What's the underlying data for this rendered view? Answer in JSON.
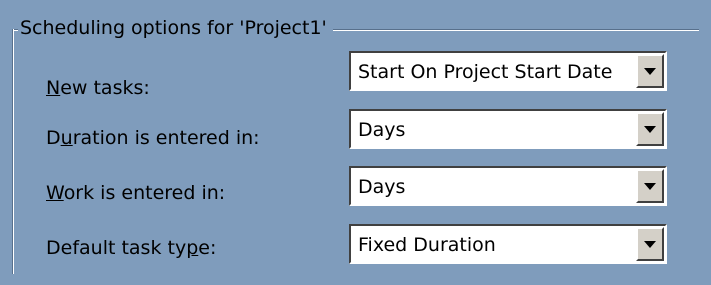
{
  "group": {
    "title": "Scheduling options for 'Project1'"
  },
  "rows": [
    {
      "label_pre": "",
      "label_key": "N",
      "label_post": "ew tasks:",
      "value": "Start On Project Start Date"
    },
    {
      "label_pre": "D",
      "label_key": "u",
      "label_post": "ration is entered in:",
      "value": "Days"
    },
    {
      "label_pre": "",
      "label_key": "W",
      "label_post": "ork is entered in:",
      "value": "Days"
    },
    {
      "label_pre": "Default task ty",
      "label_key": "p",
      "label_post": "e:",
      "value": "Fixed Duration"
    }
  ],
  "icons": {
    "dropdown": "chevron-down-icon"
  }
}
